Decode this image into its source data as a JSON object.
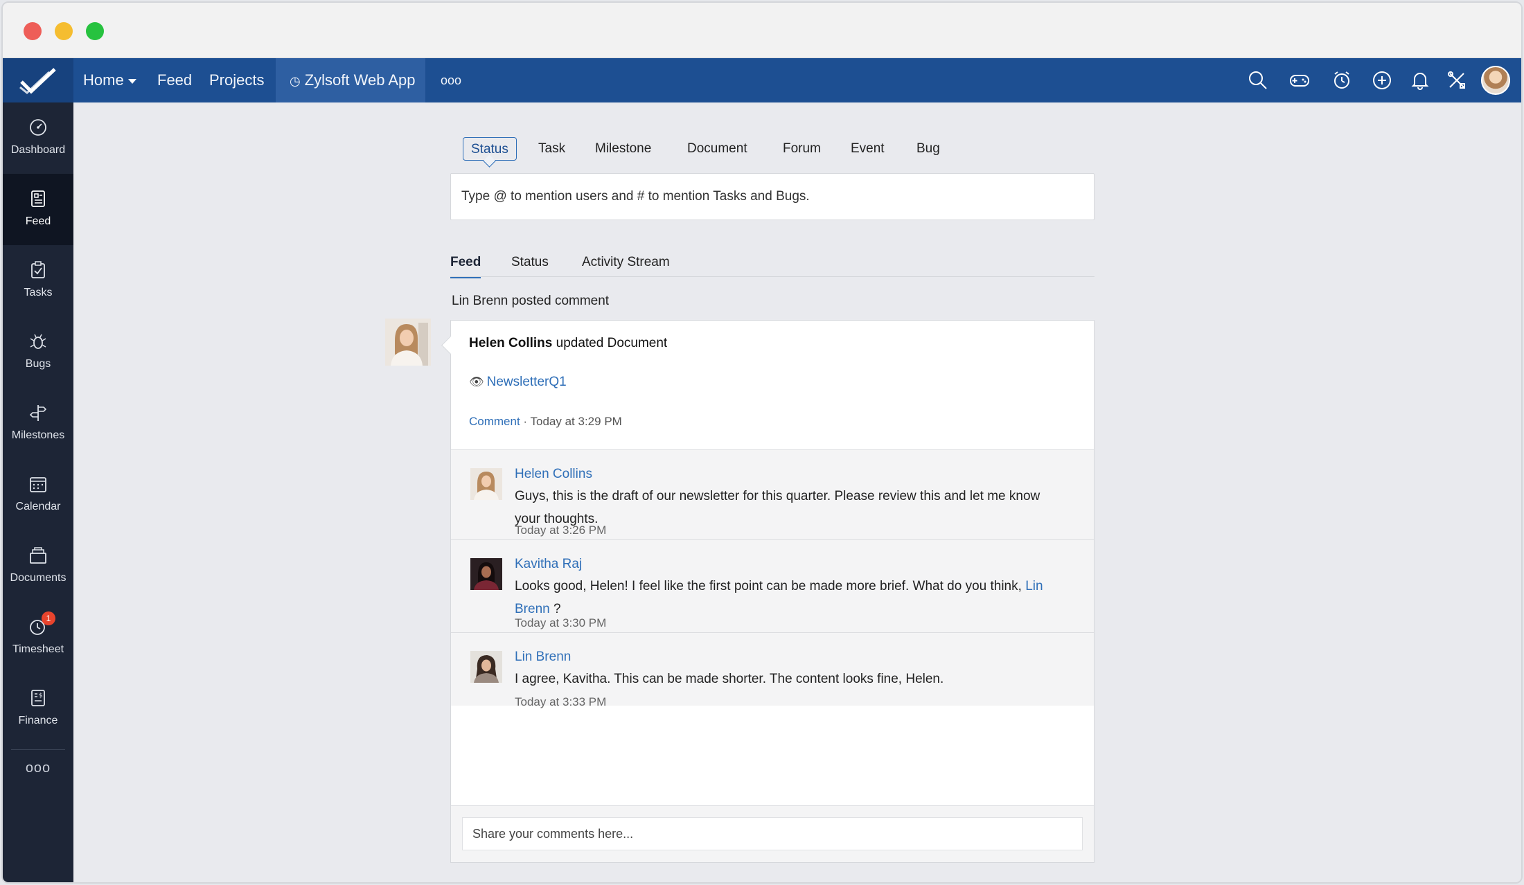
{
  "topnav": {
    "home": "Home",
    "feed": "Feed",
    "projects": "Projects",
    "project_name": "Zylsoft Web App",
    "more": "ooo"
  },
  "sidebar": {
    "items": [
      {
        "label": "Dashboard",
        "icon": "dashboard-icon"
      },
      {
        "label": "Feed",
        "icon": "feed-icon"
      },
      {
        "label": "Tasks",
        "icon": "tasks-icon"
      },
      {
        "label": "Bugs",
        "icon": "bug-icon"
      },
      {
        "label": "Milestones",
        "icon": "milestone-icon"
      },
      {
        "label": "Calendar",
        "icon": "calendar-icon"
      },
      {
        "label": "Documents",
        "icon": "documents-icon"
      },
      {
        "label": "Timesheet",
        "icon": "timesheet-icon",
        "badge": "1"
      },
      {
        "label": "Finance",
        "icon": "finance-icon"
      }
    ],
    "more": "ooo"
  },
  "compose": {
    "tabs": [
      "Status",
      "Task",
      "Milestone",
      "Document",
      "Forum",
      "Event",
      "Bug"
    ],
    "active_tab": "Status",
    "placeholder": "Type @ to mention users and # to mention Tasks and Bugs."
  },
  "feed_tabs": [
    "Feed",
    "Status",
    "Activity Stream"
  ],
  "post": {
    "header": "Lin Brenn posted comment",
    "title_name": "Helen Collins",
    "title_action": "updated Document",
    "doc_name": "NewsletterQ1",
    "comment_link": "Comment",
    "separator": "·",
    "timestamp": "Today at 3:29 PM"
  },
  "comments": [
    {
      "name": "Helen Collins",
      "text": "Guys, this is the draft of our newsletter for this quarter. Please review this and let me know your thoughts.",
      "time": "Today at 3:26 PM"
    },
    {
      "name": "Kavitha Raj",
      "text_before": "Looks good, Helen! I feel like the first point can be made more brief. What do you think, ",
      "mention": "Lin Brenn",
      "text_after": " ?",
      "time": "Today at 3:30 PM"
    },
    {
      "name": "Lin Brenn",
      "text": "I agree, Kavitha. This can be made shorter. The content looks fine, Helen.",
      "time": "Today at 3:33 PM"
    }
  ],
  "reply": {
    "placeholder": "Share your comments here..."
  },
  "colors": {
    "nav_blue": "#1d4f92",
    "sidebar_dark": "#1d2536",
    "link_blue": "#2f6fb8",
    "badge_red": "#e8442d"
  }
}
